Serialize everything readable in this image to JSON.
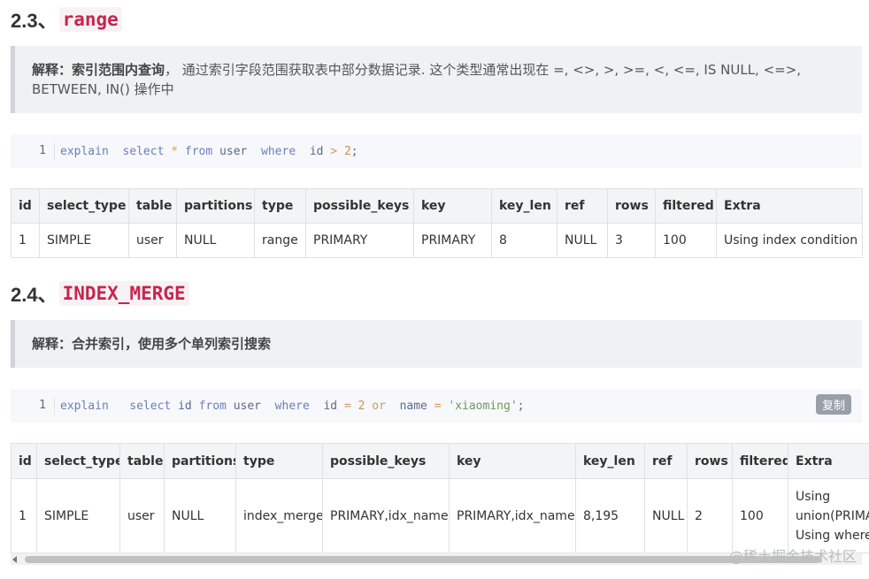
{
  "section_range": {
    "number": "2.3、",
    "keyword": "range",
    "note_label": "解释：索引范围内查询",
    "note_text": "， 通过索引字段范围获取表中部分数据记录. 这个类型通常出现在 =, <>, >, >=, <, <=, IS NULL, <=>, BETWEEN, IN() 操作中",
    "code": {
      "line": "1",
      "explain": "explain",
      "select": "select",
      "star": "*",
      "from": "from",
      "table": "user",
      "where": "where",
      "col": "id",
      "op": ">",
      "val": "2",
      "end": ";"
    },
    "table": {
      "headers": [
        "id",
        "select_type",
        "table",
        "partitions",
        "type",
        "possible_keys",
        "key",
        "key_len",
        "ref",
        "rows",
        "filtered",
        "Extra"
      ],
      "row": [
        "1",
        "SIMPLE",
        "user",
        "NULL",
        "range",
        "PRIMARY",
        "PRIMARY",
        "8",
        "NULL",
        "3",
        "100",
        "Using index condition"
      ]
    }
  },
  "section_index_merge": {
    "number": "2.4、",
    "keyword": "INDEX_MERGE",
    "note_label": "解释：合并索引，使用多个单列索引搜索",
    "code": {
      "line": "1",
      "explain": "explain",
      "select": "select",
      "col1": "id",
      "from": "from",
      "table": "user",
      "where": "where",
      "col2": "id",
      "eq1": "=",
      "val1": "2",
      "or": "or",
      "col3": "name",
      "eq2": "=",
      "val2": "'xiaoming'",
      "end": ";",
      "copy_label": "复制"
    },
    "table": {
      "headers": [
        "id",
        "select_type",
        "table",
        "partitions",
        "type",
        "possible_keys",
        "key",
        "key_len",
        "ref",
        "rows",
        "filtered",
        "Extra"
      ],
      "row": [
        "1",
        "SIMPLE",
        "user",
        "NULL",
        "index_merge",
        "PRIMARY,idx_name",
        "PRIMARY,idx_name",
        "8,195",
        "NULL",
        "2",
        "100"
      ],
      "extra_lines": [
        "Using",
        "union(PRIMA",
        "Using where"
      ]
    }
  },
  "watermark": "@稀土掘金技术社区"
}
